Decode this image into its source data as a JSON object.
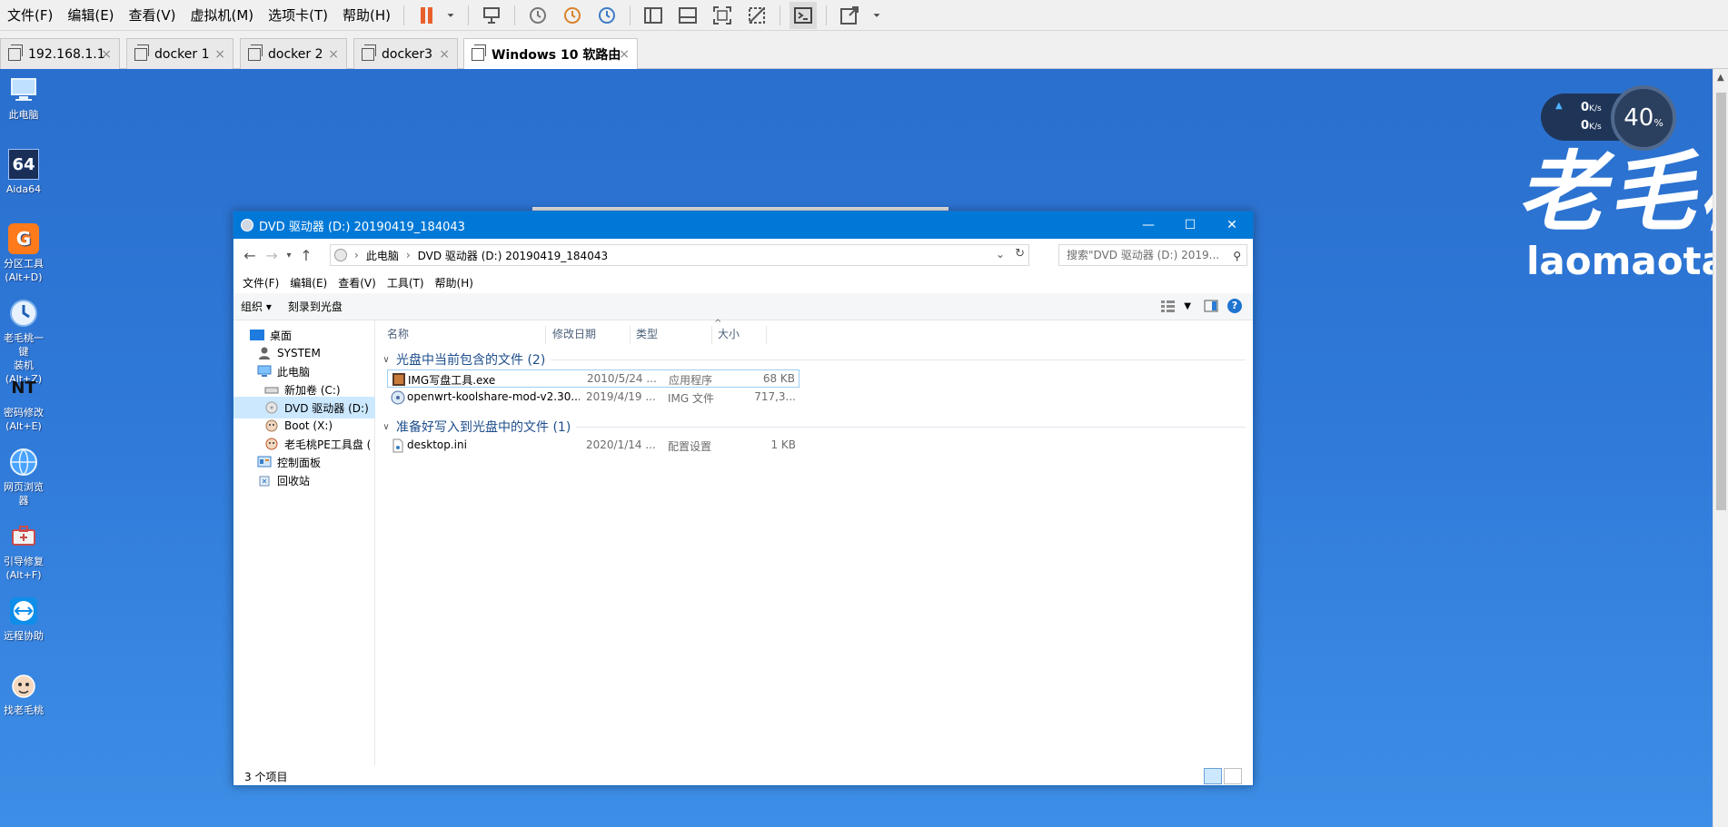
{
  "vmware": {
    "menu": [
      "文件(F)",
      "编辑(E)",
      "查看(V)",
      "虚拟机(M)",
      "选项卡(T)",
      "帮助(H)"
    ],
    "toolbar_icons": [
      "pause-icon",
      "send-keys-icon",
      "snapshot-icon",
      "revert-snapshot-icon",
      "snapshot-manager-icon",
      "sidebar-icon",
      "thumbnail-bar-icon",
      "fullscreen-icon",
      "unity-icon",
      "console-icon",
      "stretch-icon"
    ],
    "tabs": [
      {
        "label": "192.168.1.1",
        "active": false
      },
      {
        "label": "docker 1",
        "active": false
      },
      {
        "label": "docker 2",
        "active": false
      },
      {
        "label": "docker3",
        "active": false
      },
      {
        "label": "Windows 10 软路由",
        "active": true
      }
    ],
    "tab_close": "×"
  },
  "desktop": {
    "icons": [
      {
        "label": "此电脑",
        "icon": "computer-icon"
      },
      {
        "label": "Aida64",
        "icon": "aida64-icon",
        "glyph": "64"
      },
      {
        "label": "分区工具\n(Alt+D)",
        "icon": "partition-tool-icon",
        "glyph": "G"
      },
      {
        "label": "老毛桃一键\n装机(Alt+Z)",
        "icon": "one-key-install-icon"
      },
      {
        "label": "密码修改\n(Alt+E)",
        "icon": "password-reset-icon",
        "glyph": "NT"
      },
      {
        "label": "网页浏览器",
        "icon": "web-browser-icon"
      },
      {
        "label": "引导修复\n(Alt+F)",
        "icon": "boot-repair-icon"
      },
      {
        "label": "远程协助",
        "icon": "teamviewer-icon"
      },
      {
        "label": "找老毛桃",
        "icon": "find-laomaotao-icon"
      }
    ],
    "brand_cn": "老毛桃",
    "brand_en": "laomaotao.",
    "monitor": {
      "up": "0",
      "down": "0",
      "unit": "K/s",
      "percent": "40",
      "percent_sign": "%"
    }
  },
  "explorer": {
    "title": "DVD 驱动器 (D:) 20190419_184043",
    "window_buttons": {
      "minimize": "—",
      "maximize": "☐",
      "close": "✕"
    },
    "breadcrumb": [
      "此电脑",
      "DVD 驱动器 (D:) 20190419_184043"
    ],
    "search_placeholder": "搜索\"DVD 驱动器 (D:) 2019...",
    "menu": [
      "文件(F)",
      "编辑(E)",
      "查看(V)",
      "工具(T)",
      "帮助(H)"
    ],
    "commands": {
      "organize": "组织 ▾",
      "burn": "刻录到光盘"
    },
    "nav": [
      {
        "label": "桌面",
        "indent": 18,
        "icon": "desktop-folder-icon",
        "selected": false
      },
      {
        "label": "SYSTEM",
        "indent": 26,
        "icon": "user-folder-icon",
        "selected": false
      },
      {
        "label": "此电脑",
        "indent": 26,
        "icon": "this-pc-icon",
        "selected": false
      },
      {
        "label": "新加卷 (C:)",
        "indent": 34,
        "icon": "drive-icon",
        "selected": false
      },
      {
        "label": "DVD 驱动器 (D:)",
        "indent": 34,
        "icon": "dvd-drive-icon",
        "selected": true
      },
      {
        "label": "Boot (X:)",
        "indent": 34,
        "icon": "boot-drive-icon",
        "selected": false
      },
      {
        "label": "老毛桃PE工具盘 (",
        "indent": 34,
        "icon": "pe-drive-icon",
        "selected": false
      },
      {
        "label": "控制面板",
        "indent": 26,
        "icon": "control-panel-icon",
        "selected": false
      },
      {
        "label": "回收站",
        "indent": 26,
        "icon": "recycle-bin-icon",
        "selected": false
      }
    ],
    "columns": [
      "名称",
      "修改日期",
      "类型",
      "大小"
    ],
    "sort_indicator": "^",
    "groups": [
      {
        "label": "光盘中当前包含的文件 (2)",
        "files": [
          {
            "name": "IMG写盘工具.exe",
            "date": "2010/5/24 ...",
            "type": "应用程序",
            "size": "68 KB",
            "icon": "exe-icon"
          },
          {
            "name": "openwrt-koolshare-mod-v2.30...",
            "date": "2019/4/19 ...",
            "type": "IMG 文件",
            "size": "717,3...",
            "icon": "img-file-icon"
          }
        ]
      },
      {
        "label": "准备好写入到光盘中的文件 (1)",
        "files": [
          {
            "name": "desktop.ini",
            "date": "2020/1/14 ...",
            "type": "配置设置",
            "size": "1 KB",
            "icon": "ini-file-icon"
          }
        ]
      }
    ],
    "status": "3 个项目"
  }
}
